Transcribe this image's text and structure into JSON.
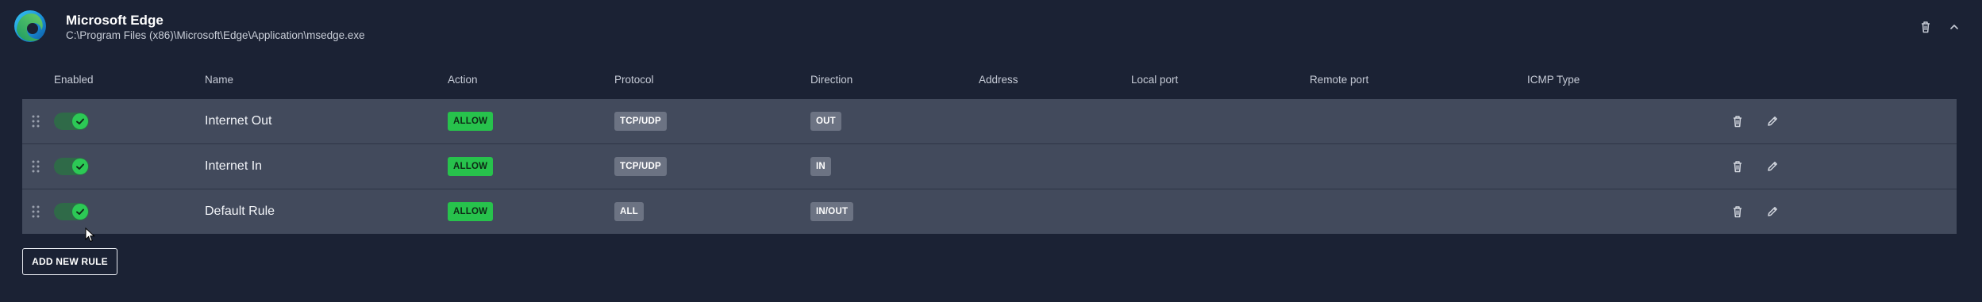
{
  "app": {
    "name": "Microsoft Edge",
    "path": "C:\\Program Files (x86)\\Microsoft\\Edge\\Application\\msedge.exe",
    "icon": "edge-logo"
  },
  "columns": {
    "enabled": "Enabled",
    "name": "Name",
    "action": "Action",
    "protocol": "Protocol",
    "direction": "Direction",
    "address": "Address",
    "local_port": "Local port",
    "remote_port": "Remote port",
    "icmp_type": "ICMP Type"
  },
  "rules": [
    {
      "enabled": true,
      "name": "Internet Out",
      "action": "ALLOW",
      "protocol": "TCP/UDP",
      "direction": "OUT"
    },
    {
      "enabled": true,
      "name": "Internet In",
      "action": "ALLOW",
      "protocol": "TCP/UDP",
      "direction": "IN"
    },
    {
      "enabled": true,
      "name": "Default Rule",
      "action": "ALLOW",
      "protocol": "ALL",
      "direction": "IN/OUT"
    }
  ],
  "actions": {
    "add_rule": "ADD NEW RULE"
  },
  "colors": {
    "background": "#1b2234",
    "row": "#424a5c",
    "allow": "#27c24c",
    "toggle_on": "#2cc955",
    "badge_neutral": "#6c7383"
  },
  "icons": {
    "header_delete": "trash-icon",
    "header_collapse": "chevron-up-icon",
    "row_delete": "trash-icon",
    "row_edit": "pencil-icon",
    "drag": "drag-handle-icon"
  }
}
